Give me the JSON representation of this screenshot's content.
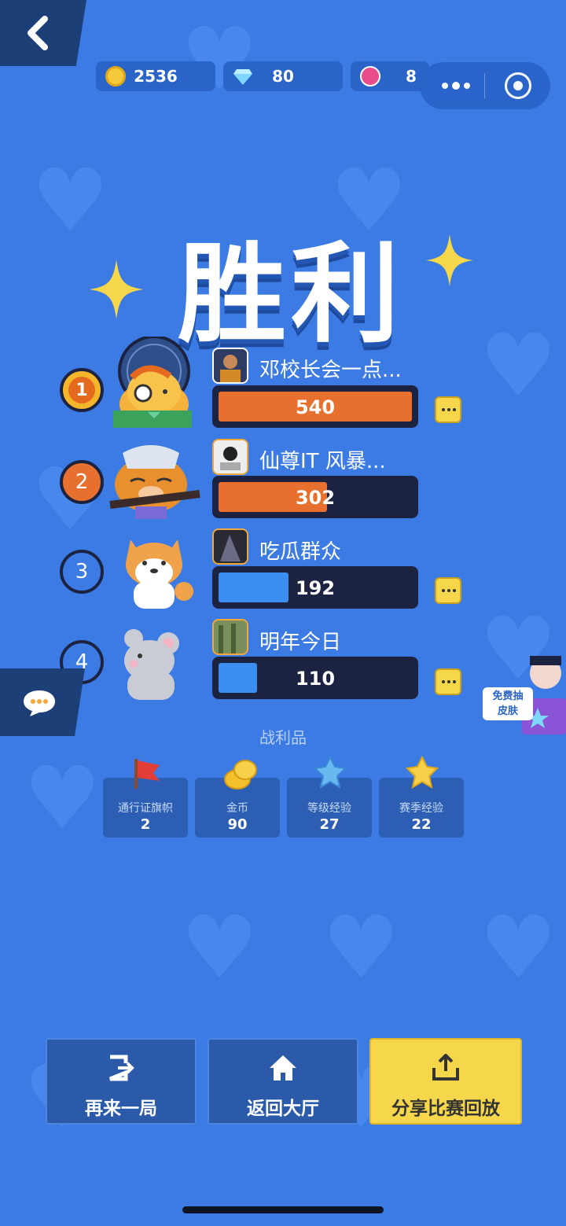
{
  "resources": [
    {
      "icon": "gold-coin-icon",
      "value": "2536",
      "color": "#f6c93a"
    },
    {
      "icon": "diamond-icon",
      "value": "80",
      "color": "#7fd6ff"
    },
    {
      "icon": "lotus-token-icon",
      "value": "8",
      "color": "#e94c8a"
    }
  ],
  "title": "胜利",
  "players": [
    {
      "rank": "1",
      "name": "邓校长会一点...",
      "score": "540",
      "fraction": 1.0,
      "bar_color": "#e8702e",
      "badge_color": "#f3b52a",
      "has_more": true
    },
    {
      "rank": "2",
      "name": "仙尊IT 风暴...",
      "score": "302",
      "fraction": 0.56,
      "bar_color": "#e8702e",
      "badge_color": "#e8702e",
      "has_more": false
    },
    {
      "rank": "3",
      "name": "吃瓜群众",
      "score": "192",
      "fraction": 0.36,
      "bar_color": "#3a8ef0",
      "badge_color": "#3c7be3",
      "has_more": true
    },
    {
      "rank": "4",
      "name": "明年今日",
      "score": "110",
      "fraction": 0.2,
      "bar_color": "#3a8ef0",
      "badge_color": "#3c7be3",
      "has_more": true
    }
  ],
  "promo": {
    "line1": "免费抽",
    "line2": "皮肤"
  },
  "loot": {
    "title": "战利品",
    "items": [
      {
        "label": "通行证旗帜",
        "value": "2",
        "icon": "flag-icon"
      },
      {
        "label": "金币",
        "value": "90",
        "icon": "coins-icon"
      },
      {
        "label": "等级经验",
        "value": "27",
        "icon": "blue-star-icon"
      },
      {
        "label": "赛季经验",
        "value": "22",
        "icon": "yellow-star-icon"
      }
    ]
  },
  "buttons": {
    "again": "再来一局",
    "lobby": "返回大厅",
    "share": "分享比赛回放"
  }
}
